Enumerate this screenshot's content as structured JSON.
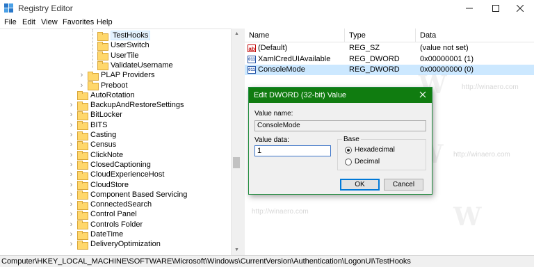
{
  "window": {
    "title": "Registry Editor"
  },
  "menu": [
    "File",
    "Edit",
    "View",
    "Favorites",
    "Help"
  ],
  "tree": [
    {
      "label": "TestHooks",
      "indent": 2,
      "expander": "",
      "selected": true
    },
    {
      "label": "UserSwitch",
      "indent": 2,
      "expander": ""
    },
    {
      "label": "UserTile",
      "indent": 2,
      "expander": ""
    },
    {
      "label": "ValidateUsername",
      "indent": 2,
      "expander": ""
    },
    {
      "label": "PLAP Providers",
      "indent": 1,
      "expander": ">"
    },
    {
      "label": "Preboot",
      "indent": 1,
      "expander": ">"
    },
    {
      "label": "AutoRotation",
      "indent": 0,
      "expander": ""
    },
    {
      "label": "BackupAndRestoreSettings",
      "indent": 0,
      "expander": ">"
    },
    {
      "label": "BitLocker",
      "indent": 0,
      "expander": ">"
    },
    {
      "label": "BITS",
      "indent": 0,
      "expander": ">"
    },
    {
      "label": "Casting",
      "indent": 0,
      "expander": ">"
    },
    {
      "label": "Census",
      "indent": 0,
      "expander": ">"
    },
    {
      "label": "ClickNote",
      "indent": 0,
      "expander": ">"
    },
    {
      "label": "ClosedCaptioning",
      "indent": 0,
      "expander": ">"
    },
    {
      "label": "CloudExperienceHost",
      "indent": 0,
      "expander": ">"
    },
    {
      "label": "CloudStore",
      "indent": 0,
      "expander": ">"
    },
    {
      "label": "Component Based Servicing",
      "indent": 0,
      "expander": ">"
    },
    {
      "label": "ConnectedSearch",
      "indent": 0,
      "expander": ">"
    },
    {
      "label": "Control Panel",
      "indent": 0,
      "expander": ">"
    },
    {
      "label": "Controls Folder",
      "indent": 0,
      "expander": ">"
    },
    {
      "label": "DateTime",
      "indent": 0,
      "expander": ">"
    },
    {
      "label": "DeliveryOptimization",
      "indent": 0,
      "expander": ">"
    }
  ],
  "list": {
    "columns": [
      "Name",
      "Type",
      "Data"
    ],
    "rows": [
      {
        "icon": "ab",
        "name": "(Default)",
        "type": "REG_SZ",
        "data": "(value not set)",
        "selected": false
      },
      {
        "icon": "dw",
        "name": "XamlCredUIAvailable",
        "type": "REG_DWORD",
        "data": "0x00000001 (1)",
        "selected": false
      },
      {
        "icon": "dw",
        "name": "ConsoleMode",
        "type": "REG_DWORD",
        "data": "0x00000000 (0)",
        "selected": true
      }
    ]
  },
  "dialog": {
    "title": "Edit DWORD (32-bit) Value",
    "value_name_label": "Value name:",
    "value_name": "ConsoleMode",
    "value_data_label": "Value data:",
    "value_data": "1",
    "base_label": "Base",
    "radio_hex": "Hexadecimal",
    "radio_dec": "Decimal",
    "selected_base": "Hexadecimal",
    "ok": "OK",
    "cancel": "Cancel"
  },
  "status": {
    "path": "Computer\\HKEY_LOCAL_MACHINE\\SOFTWARE\\Microsoft\\Windows\\CurrentVersion\\Authentication\\LogonUI\\TestHooks"
  },
  "watermark": {
    "letter": "W",
    "url": "http://winaero.com"
  },
  "colors": {
    "dialog_title": "#107c10",
    "selection": "#cce8ff",
    "folder": "#ffd76b"
  }
}
